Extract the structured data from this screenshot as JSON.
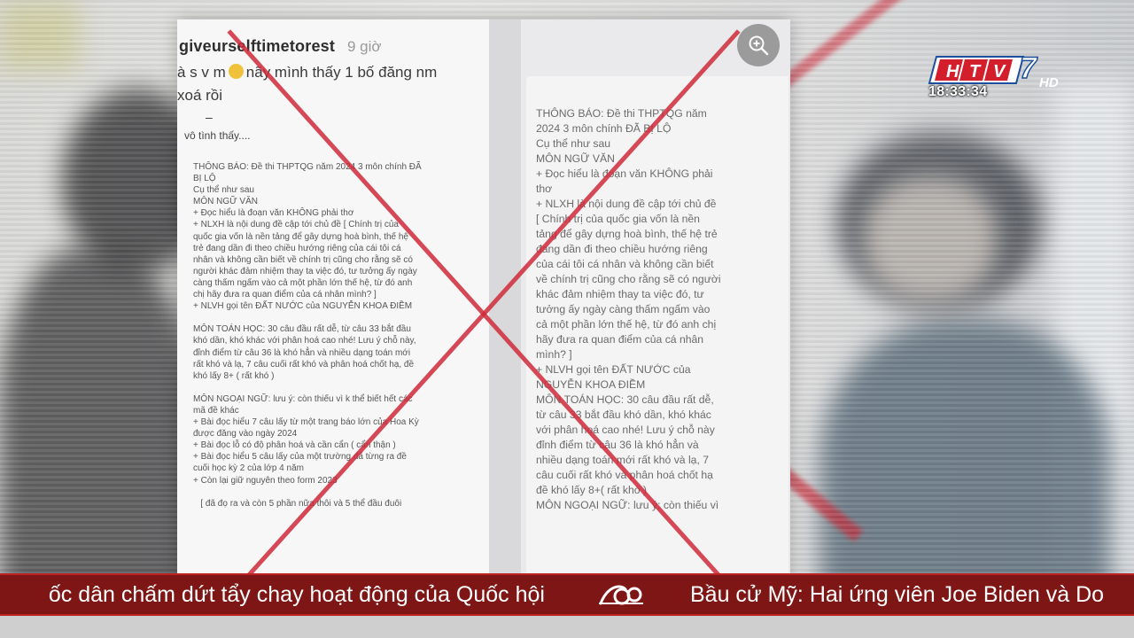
{
  "channel": {
    "name": "HTV7",
    "hd_badge": "HD",
    "clock": "18:33:34",
    "brand_colors": {
      "red": "#d21f2b",
      "blue": "#1d4f9c"
    }
  },
  "document": {
    "username": "giveurselftimetorest",
    "post_time": "9 giờ",
    "comment_line_1_a": "à s v m",
    "comment_line_1_b": "nãy mình thấy 1 bố đăng nm",
    "comment_line_2": "xoá rồi",
    "dash": "–",
    "reply_note": "vô tình thấy....",
    "left_post_text": "THÔNG BÁO: Đề thi THPTQG năm 2024 3 môn chính ĐÃ\nBỊ LỘ\nCụ thể như sau\nMÔN NGỮ VĂN\n+ Đọc hiểu là đoạn văn KHÔNG phải thơ\n+ NLXH là nội dung đề cập tới chủ đề [ Chính trị của\nquốc gia vốn là nền tảng để gây dựng hoà bình, thế hệ\ntrẻ đang dần đi theo chiều hướng riêng của cái tôi cá\nnhân và không cần biết về chính trị cũng cho rằng sẽ có\nngười khác đảm nhiệm thay ta việc đó, tư tưởng ấy ngày\ncàng thấm ngấm vào cả một phần lớn thế hệ, từ đó anh\nchị hãy đưa ra quan điểm của cá nhân mình? ]\n+ NLVH gọi tên ĐẤT NƯỚC của NGUYỄN KHOA ĐIỀM\n\nMÔN TOÁN HỌC: 30 câu đầu rất dễ, từ câu 33 bắt đầu\nkhó dần, khó khác với phân hoá cao nhé! Lưu ý chỗ này,\nđỉnh điểm từ câu 36 là khó hẳn và nhiều dạng toán mới\nrất khó và lạ, 7 câu cuối rất khó và phân hoá chốt hạ, đề\nkhó lấy 8+ ( rất khó )\n\nMÔN NGOẠI NGỮ: lưu ý: còn thiếu vì k thể biết hết các\nmã đề khác\n+ Bài đọc hiểu 7 câu lấy từ một trang báo lớn của Hoa Kỳ\nđược đăng vào ngày 2024\n+ Bài đọc lỗ có độ phân hoá và cần cẩn ( cẩn thận )\n+ Bài đọc hiểu 5 câu lấy của một trường đã từng ra đề\ncuối học kỳ 2 của lớp 4 năm\n+ Còn lại giữ nguyên theo form 2023\n\n   [ đã đọ ra và còn 5 phần nữa thôi và 5 thể đầu đuôi",
    "right_post_text": "THÔNG BÁO: Đề thi THPTQG năm\n2024 3 môn chính ĐÃ BỊ LỘ\nCụ thể như sau\nMÔN NGỮ VĂN\n+ Đọc hiểu là đoạn văn KHÔNG phải\nthơ\n+ NLXH là nội dung đề cập tới chủ đề\n[ Chính trị của quốc gia vốn là nền\ntảng để gây dựng hoà bình, thế hệ trẻ\nđang dần đi theo chiều hướng riêng\ncủa cái tôi cá nhân và không cần biết\nvề chính trị cũng cho rằng sẽ có người\nkhác đảm nhiệm thay ta việc đó, tư\ntưởng ấy ngày càng thấm ngấm vào\ncả một phần lớn thế hệ, từ đó anh chị\nhãy đưa ra quan điểm của cá nhân\nmình? ]\n+ NLVH gọi tên ĐẤT NƯỚC của\nNGUYỄN KHOA ĐIỀM\nMÔN TOÁN HỌC: 30 câu đầu rất dễ,\ntừ câu 33 bắt đầu khó dần, khó khác\nvới phân hoá cao nhé! Lưu ý chỗ này\nđỉnh điểm từ câu 36 là khó hẳn và\nnhiều dạng toán mới rất khó và lạ, 7\ncâu cuối rất khó và phân hoá chốt hạ\nđề khó lấy 8+( rất khó )\nMÔN NGOẠI NGỮ: lưu ý: còn thiếu vì"
  },
  "icons": {
    "zoom": "zoom-in-icon",
    "ticker_separator": "htv-ticker-logo-icon"
  },
  "ticker": {
    "left_text": "ốc dân chấm dứt tẩy chay hoạt động của Quốc hội",
    "right_text": "Bầu cử Mỹ: Hai ứng viên Joe Biden và Do"
  }
}
